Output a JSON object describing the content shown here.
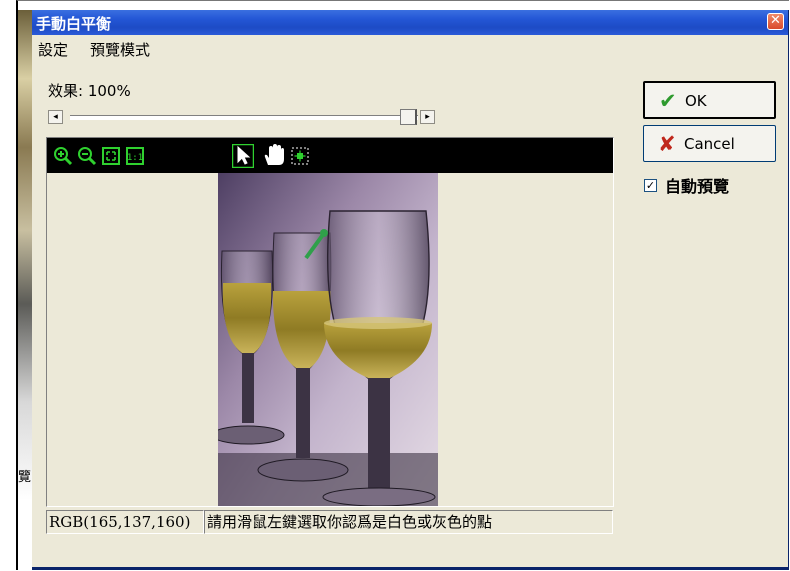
{
  "dialog": {
    "title": "手動白平衡",
    "close_glyph": "✕"
  },
  "menu": [
    "設定",
    "預覽模式"
  ],
  "effect": {
    "label": "效果: 100%",
    "value_percent": 100,
    "left_arrow": "◂",
    "right_arrow": "▸"
  },
  "toolbar": {
    "icons": [
      "zoom-in-icon",
      "zoom-out-icon",
      "fit-window-icon",
      "actual-size-icon",
      "pointer-icon",
      "hand-pan-icon",
      "eyedropper-select-icon"
    ],
    "fit_glyph": "⛶",
    "actual_size_glyph": "1:1"
  },
  "status": {
    "rgb": "RGB(165,137,160)",
    "message": "請用滑鼠左鍵選取你認爲是白色或灰色的點"
  },
  "buttons": {
    "ok_label": "OK",
    "ok_glyph": "✔",
    "cancel_label": "Cancel",
    "cancel_glyph": "✘"
  },
  "auto_preview": {
    "label": "自動預覽",
    "checked": true,
    "check_glyph": "✓"
  },
  "background": {
    "partial_glyph": "覽"
  },
  "colors": {
    "title_blue": "#2457d6",
    "dialog_bg": "#ece9d8",
    "ok_check": "#2e9a2e",
    "cancel_x": "#c0271b",
    "toolbar_bg": "#000000",
    "toolbar_icon_green": "#2fd12f"
  }
}
